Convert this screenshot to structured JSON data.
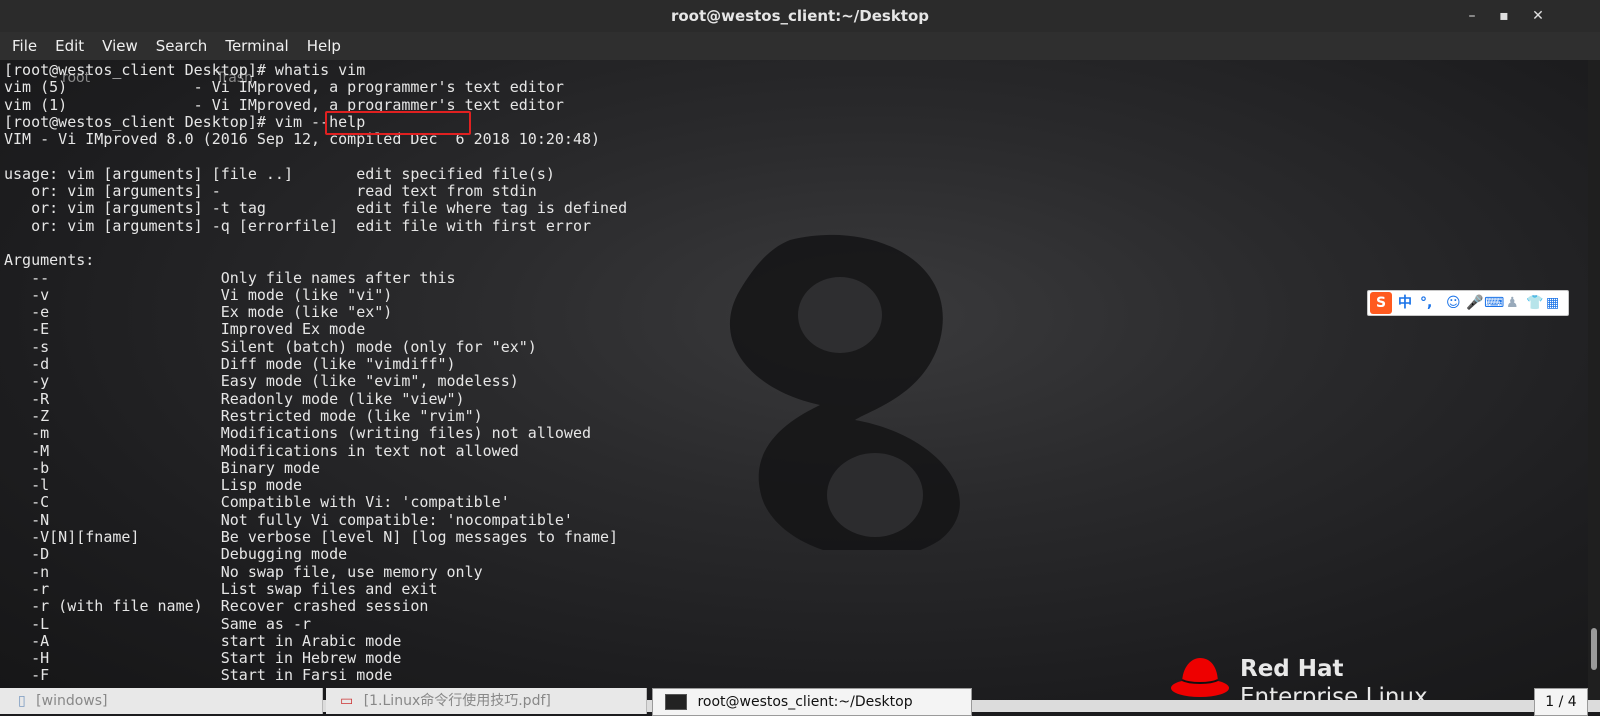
{
  "window": {
    "title": "root@westos_client:~/Desktop",
    "minimize_glyph": "–",
    "maximize_glyph": "▪",
    "close_glyph": "✕"
  },
  "menu": [
    "File",
    "Edit",
    "View",
    "Search",
    "Terminal",
    "Help"
  ],
  "desktop": {
    "icon_labels": [
      "root",
      "Trash"
    ],
    "brand_line1": "Red Hat",
    "brand_line2": "Enterprise Linux"
  },
  "terminal": {
    "highlighted_command": "vim --help",
    "lines": [
      "[root@westos_client Desktop]# whatis vim",
      "vim (5)              - Vi IMproved, a programmer's text editor",
      "vim (1)              - Vi IMproved, a programmer's text editor",
      "[root@westos_client Desktop]# vim --help",
      "VIM - Vi IMproved 8.0 (2016 Sep 12, compiled Dec  6 2018 10:20:48)",
      "",
      "usage: vim [arguments] [file ..]       edit specified file(s)",
      "   or: vim [arguments] -               read text from stdin",
      "   or: vim [arguments] -t tag          edit file where tag is defined",
      "   or: vim [arguments] -q [errorfile]  edit file with first error",
      "",
      "Arguments:",
      "   --                   Only file names after this",
      "   -v                   Vi mode (like \"vi\")",
      "   -e                   Ex mode (like \"ex\")",
      "   -E                   Improved Ex mode",
      "   -s                   Silent (batch) mode (only for \"ex\")",
      "   -d                   Diff mode (like \"vimdiff\")",
      "   -y                   Easy mode (like \"evim\", modeless)",
      "   -R                   Readonly mode (like \"view\")",
      "   -Z                   Restricted mode (like \"rvim\")",
      "   -m                   Modifications (writing files) not allowed",
      "   -M                   Modifications in text not allowed",
      "   -b                   Binary mode",
      "   -l                   Lisp mode",
      "   -C                   Compatible with Vi: 'compatible'",
      "   -N                   Not fully Vi compatible: 'nocompatible'",
      "   -V[N][fname]         Be verbose [level N] [log messages to fname]",
      "   -D                   Debugging mode",
      "   -n                   No swap file, use memory only",
      "   -r                   List swap files and exit",
      "   -r (with file name)  Recover crashed session",
      "   -L                   Same as -r",
      "   -A                   start in Arabic mode",
      "   -H                   Start in Hebrew mode",
      "   -F                   Start in Farsi mode"
    ]
  },
  "ime_toolbar": {
    "logo": "S",
    "mode": "中",
    "punct": "°,",
    "icons": [
      "smiley-icon",
      "microphone-icon",
      "keyboard-icon",
      "user-icon",
      "shirt-icon",
      "grid-icon"
    ]
  },
  "taskbar": {
    "items": [
      "[windows]",
      "[1.Linux命令行使用技巧.pdf]",
      "root@westos_client:~/Desktop"
    ],
    "pager": "1 / 4"
  },
  "colors": {
    "highlight_box": "#e02020",
    "redhat_red": "#ee0000",
    "ime_brand": "#ff5a1f"
  }
}
